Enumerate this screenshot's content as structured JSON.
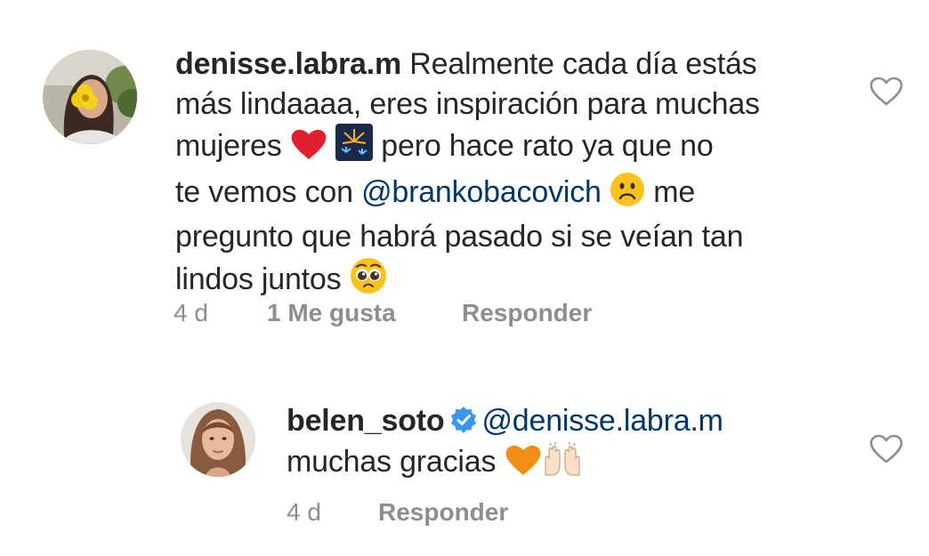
{
  "comments": [
    {
      "username": "denisse.labra.m",
      "line1": "Realmente cada día estás",
      "line2": "más lindaaaa, eres inspiración para muchas",
      "line3a": "mujeres",
      "line3b": "pero hace rato ya que no",
      "line4a": "te vemos con",
      "mention": "@brankobacovich",
      "line4b": "me",
      "line5": "pregunto que habrá pasado si se veían tan",
      "line6": "lindos juntos",
      "time": "4 d",
      "likes": "1 Me gusta",
      "reply": "Responder",
      "emojis": [
        "red-heart",
        "fireworks",
        "frowning-face",
        "pleading-face"
      ]
    },
    {
      "username": "belen_soto",
      "verified": true,
      "mention": "@denisse.labra.m",
      "line2": "muchas gracias",
      "time": "4 d",
      "reply": "Responder",
      "emojis": [
        "orange-heart",
        "raising-hands"
      ]
    }
  ],
  "colors": {
    "text": "#262626",
    "secondary": "#8e8e8e",
    "mention": "#00376b",
    "verified": "#3897f0"
  }
}
